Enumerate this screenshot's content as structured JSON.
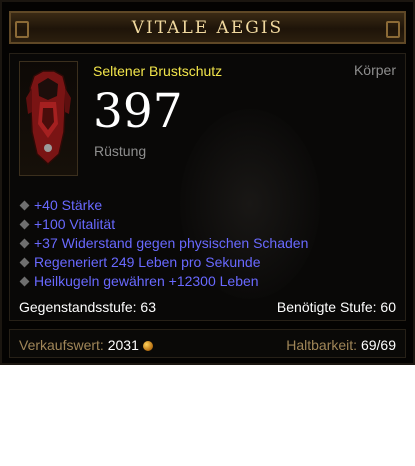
{
  "item": {
    "title": "VITALE AEGIS",
    "name": "Seltener Brustschutz",
    "slot": "Körper",
    "armor_value": "397",
    "armor_label": "Rüstung",
    "icon": "chest-armor-icon"
  },
  "affixes": [
    "+40 Stärke",
    "+100 Vitalität",
    "+37 Widerstand gegen physischen Schaden",
    "Regeneriert 249 Leben pro Sekunde",
    "Heilkugeln gewähren +12300 Leben"
  ],
  "stats": {
    "item_level": "Gegenstandsstufe: 63",
    "required_level": "Benötigte Stufe: 60"
  },
  "footer": {
    "sell_label": "Verkaufswert:",
    "sell_value": "2031",
    "gold_icon": "gold-coin-icon",
    "durability_label": "Haltbarkeit:",
    "durability_value": "69/69"
  },
  "colors": {
    "title": "#f0d89e",
    "rare_name": "#f3e64b",
    "affix": "#6969ff",
    "muted": "#8e8e8e",
    "footer_label": "#a08658"
  }
}
